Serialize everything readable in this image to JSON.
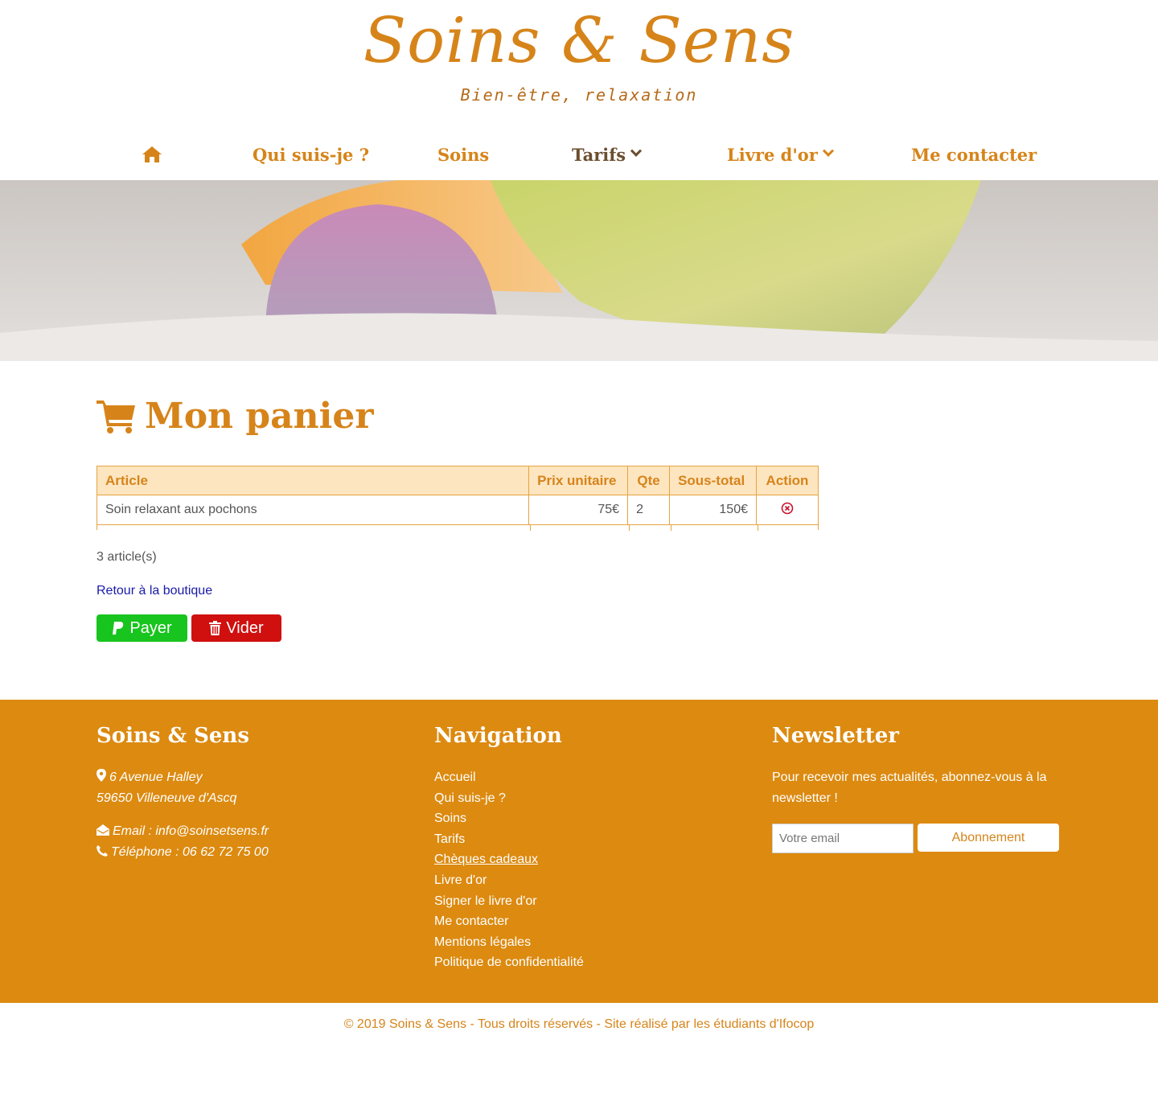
{
  "brand": {
    "name": "Soins & Sens",
    "tagline": "Bien-être, relaxation"
  },
  "nav": {
    "items": [
      {
        "label": "",
        "icon": "home-icon"
      },
      {
        "label": "Qui suis-je ?"
      },
      {
        "label": "Soins"
      },
      {
        "label": "Tarifs",
        "dropdown": true,
        "active": true
      },
      {
        "label": "Livre d'or",
        "dropdown": true
      },
      {
        "label": "Me contacter"
      }
    ]
  },
  "cart": {
    "title": "Mon panier",
    "columns": [
      "Article",
      "Prix unitaire",
      "Qte",
      "Sous-total",
      "Action"
    ],
    "rows": [
      {
        "article": "Soin relaxant aux pochons",
        "unit_price": "75€",
        "qty": "2",
        "subtotal": "150€",
        "action_icon": "remove-circle-icon"
      }
    ],
    "count_text": "3 article(s)",
    "back_link": "Retour à la boutique",
    "pay_label": "Payer",
    "clear_label": "Vider"
  },
  "footer": {
    "col1": {
      "title": "Soins & Sens",
      "address_line1": "6 Avenue Halley",
      "address_line2": "59650 Villeneuve d'Ascq",
      "email": "Email : info@soinsetsens.fr",
      "phone": "Téléphone : 06 62 72 75 00"
    },
    "col2": {
      "title": "Navigation",
      "links": [
        "Accueil",
        "Qui suis-je ?",
        "Soins",
        "Tarifs",
        "Chèques cadeaux",
        "Livre d'or",
        "Signer le livre d'or",
        "Me contacter",
        "Mentions légales",
        "Politique de confidentialité"
      ]
    },
    "col3": {
      "title": "Newsletter",
      "text": "Pour recevoir mes actualités, abonnez-vous à la newsletter !",
      "email_placeholder": "Votre email",
      "subscribe_label": "Abonnement"
    }
  },
  "copyright": "© 2019 Soins & Sens - Tous droits réservés - Site réalisé par les étudiants d'Ifocop",
  "colors": {
    "accent": "#d6841a",
    "footer_bg": "#dc8a10",
    "pay": "#18c41e",
    "clear": "#d00f0f"
  }
}
